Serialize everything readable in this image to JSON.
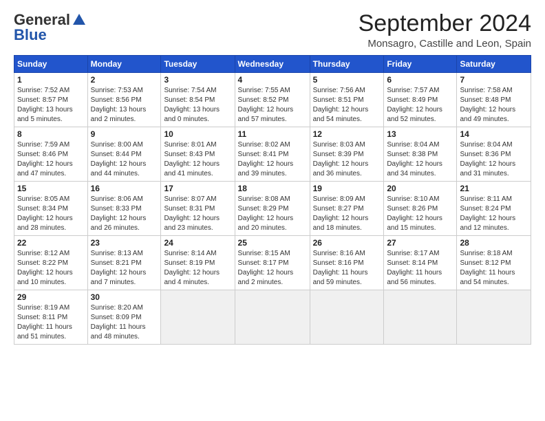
{
  "header": {
    "logo_general": "General",
    "logo_blue": "Blue",
    "month_title": "September 2024",
    "location": "Monsagro, Castille and Leon, Spain"
  },
  "weekdays": [
    "Sunday",
    "Monday",
    "Tuesday",
    "Wednesday",
    "Thursday",
    "Friday",
    "Saturday"
  ],
  "weeks": [
    [
      {
        "day": "1",
        "sunrise": "7:52 AM",
        "sunset": "8:57 PM",
        "daylight": "13 hours and 5 minutes."
      },
      {
        "day": "2",
        "sunrise": "7:53 AM",
        "sunset": "8:56 PM",
        "daylight": "13 hours and 2 minutes."
      },
      {
        "day": "3",
        "sunrise": "7:54 AM",
        "sunset": "8:54 PM",
        "daylight": "13 hours and 0 minutes."
      },
      {
        "day": "4",
        "sunrise": "7:55 AM",
        "sunset": "8:52 PM",
        "daylight": "12 hours and 57 minutes."
      },
      {
        "day": "5",
        "sunrise": "7:56 AM",
        "sunset": "8:51 PM",
        "daylight": "12 hours and 54 minutes."
      },
      {
        "day": "6",
        "sunrise": "7:57 AM",
        "sunset": "8:49 PM",
        "daylight": "12 hours and 52 minutes."
      },
      {
        "day": "7",
        "sunrise": "7:58 AM",
        "sunset": "8:48 PM",
        "daylight": "12 hours and 49 minutes."
      }
    ],
    [
      {
        "day": "8",
        "sunrise": "7:59 AM",
        "sunset": "8:46 PM",
        "daylight": "12 hours and 47 minutes."
      },
      {
        "day": "9",
        "sunrise": "8:00 AM",
        "sunset": "8:44 PM",
        "daylight": "12 hours and 44 minutes."
      },
      {
        "day": "10",
        "sunrise": "8:01 AM",
        "sunset": "8:43 PM",
        "daylight": "12 hours and 41 minutes."
      },
      {
        "day": "11",
        "sunrise": "8:02 AM",
        "sunset": "8:41 PM",
        "daylight": "12 hours and 39 minutes."
      },
      {
        "day": "12",
        "sunrise": "8:03 AM",
        "sunset": "8:39 PM",
        "daylight": "12 hours and 36 minutes."
      },
      {
        "day": "13",
        "sunrise": "8:04 AM",
        "sunset": "8:38 PM",
        "daylight": "12 hours and 34 minutes."
      },
      {
        "day": "14",
        "sunrise": "8:04 AM",
        "sunset": "8:36 PM",
        "daylight": "12 hours and 31 minutes."
      }
    ],
    [
      {
        "day": "15",
        "sunrise": "8:05 AM",
        "sunset": "8:34 PM",
        "daylight": "12 hours and 28 minutes."
      },
      {
        "day": "16",
        "sunrise": "8:06 AM",
        "sunset": "8:33 PM",
        "daylight": "12 hours and 26 minutes."
      },
      {
        "day": "17",
        "sunrise": "8:07 AM",
        "sunset": "8:31 PM",
        "daylight": "12 hours and 23 minutes."
      },
      {
        "day": "18",
        "sunrise": "8:08 AM",
        "sunset": "8:29 PM",
        "daylight": "12 hours and 20 minutes."
      },
      {
        "day": "19",
        "sunrise": "8:09 AM",
        "sunset": "8:27 PM",
        "daylight": "12 hours and 18 minutes."
      },
      {
        "day": "20",
        "sunrise": "8:10 AM",
        "sunset": "8:26 PM",
        "daylight": "12 hours and 15 minutes."
      },
      {
        "day": "21",
        "sunrise": "8:11 AM",
        "sunset": "8:24 PM",
        "daylight": "12 hours and 12 minutes."
      }
    ],
    [
      {
        "day": "22",
        "sunrise": "8:12 AM",
        "sunset": "8:22 PM",
        "daylight": "12 hours and 10 minutes."
      },
      {
        "day": "23",
        "sunrise": "8:13 AM",
        "sunset": "8:21 PM",
        "daylight": "12 hours and 7 minutes."
      },
      {
        "day": "24",
        "sunrise": "8:14 AM",
        "sunset": "8:19 PM",
        "daylight": "12 hours and 4 minutes."
      },
      {
        "day": "25",
        "sunrise": "8:15 AM",
        "sunset": "8:17 PM",
        "daylight": "12 hours and 2 minutes."
      },
      {
        "day": "26",
        "sunrise": "8:16 AM",
        "sunset": "8:16 PM",
        "daylight": "11 hours and 59 minutes."
      },
      {
        "day": "27",
        "sunrise": "8:17 AM",
        "sunset": "8:14 PM",
        "daylight": "11 hours and 56 minutes."
      },
      {
        "day": "28",
        "sunrise": "8:18 AM",
        "sunset": "8:12 PM",
        "daylight": "11 hours and 54 minutes."
      }
    ],
    [
      {
        "day": "29",
        "sunrise": "8:19 AM",
        "sunset": "8:11 PM",
        "daylight": "11 hours and 51 minutes."
      },
      {
        "day": "30",
        "sunrise": "8:20 AM",
        "sunset": "8:09 PM",
        "daylight": "11 hours and 48 minutes."
      },
      null,
      null,
      null,
      null,
      null
    ]
  ]
}
